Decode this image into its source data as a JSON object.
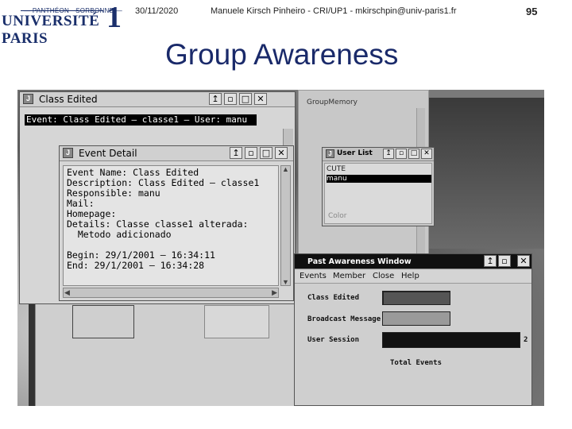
{
  "slide": {
    "logo_top": "— PANTHÉON · SORBONNE —",
    "logo_main": "UNIVERSITÉ PARIS",
    "logo_num": "1",
    "date": "30/11/2020",
    "author": "Manuele Kirsch Pinheiro - CRI/UP1 - mkirschpin@univ-paris1.fr",
    "page": "95",
    "title": "Group Awareness"
  },
  "group_memory": {
    "title": "GroupMemory"
  },
  "class_edited": {
    "title": "Class Edited",
    "event_line": "Event: Class Edited – classe1 – User: manu",
    "buttons": [
      "↥",
      "▫",
      "□",
      "✕"
    ]
  },
  "event_detail": {
    "title": "Event Detail",
    "content": "Event Name: Class Edited\nDescription: Class Edited – classe1\nResponsible: manu\nMail:\nHomepage:\nDetails: Classe classe1 alterada:\n  Metodo adicionado\n\nBegin: 29/1/2001 – 16:34:11\nEnd: 29/1/2001 – 16:34:28",
    "buttons": [
      "↥",
      "▫",
      "□",
      "✕"
    ]
  },
  "user_list": {
    "title": "User List",
    "items": [
      "CUTE",
      "manu"
    ],
    "selected": "manu",
    "footer": "Color"
  },
  "past_awareness": {
    "title": "Past Awareness Window",
    "menu": [
      "Events",
      "Member",
      "Close",
      "Help"
    ],
    "rows": [
      {
        "label": "Class Edited"
      },
      {
        "label": "Broadcast Message"
      },
      {
        "label": "User Session"
      }
    ],
    "session_suffix": "2",
    "total_label": "Total Events",
    "buttons": [
      "↥",
      "▫",
      "□",
      "✕"
    ]
  }
}
